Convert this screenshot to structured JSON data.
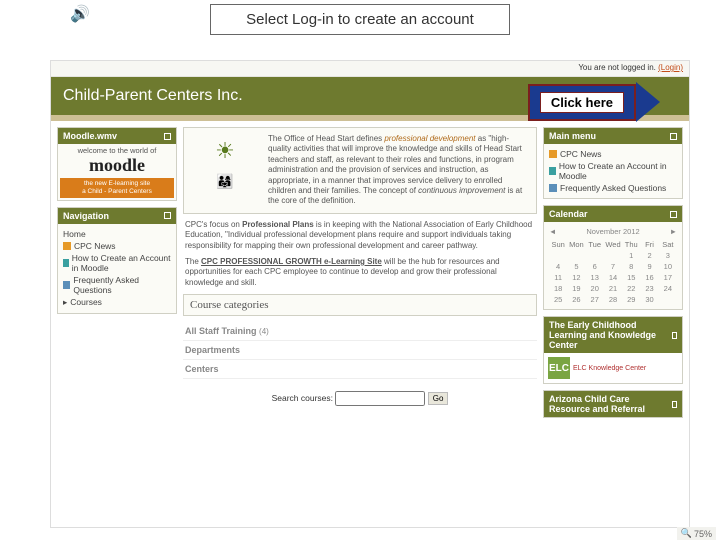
{
  "instruction": "Select Log-in to create an account",
  "callout": "Click here",
  "topbar": {
    "prefix": "You are not logged in.",
    "login_link": "(Login)"
  },
  "header": {
    "title": "Child-Parent Centers Inc."
  },
  "moodle_block": {
    "hd": "Moodle.wmv",
    "line1": "welcome to the world of",
    "logo": "moodle",
    "bar1": "the new E-learning site",
    "bar2": "a Child - Parent Centers"
  },
  "nav_block": {
    "hd": "Navigation",
    "home": "Home",
    "news": "CPC News",
    "create": "How to Create an Account in Moodle",
    "faq": "Frequently Asked Questions",
    "courses": "Courses",
    "arrow": "▸"
  },
  "intro": {
    "p1a": "The Office of Head Start defines ",
    "p1b": "professional development",
    "p1c": " as \"high-quality activities that will improve the knowledge and skills of Head Start teachers and staff, as relevant to their roles and functions, in program administration and the provision of services and instruction, as appropriate, in a manner that improves service delivery to enrolled children and their families. The concept of ",
    "p1d": "continuous improvement",
    "p1e": " is at the core of the definition."
  },
  "para2": {
    "a": "CPC's focus on ",
    "b": "Professional Plans",
    "c": " is in keeping with the National Association of Early Childhood Education, \"Individual professional development plans require and support individuals taking responsibility for mapping their own professional development and career pathway."
  },
  "para3": {
    "a": "The ",
    "b": "CPC PROFESSIONAL GROWTH e-Learning Site",
    "c": " will be the hub for resources and opportunities for each CPC employee to continue to develop and grow their professional knowledge and skill."
  },
  "course_cat": {
    "hd": "Course categories",
    "c1": "All Staff Training",
    "c1_count": "(4)",
    "c2": "Departments",
    "c3": "Centers"
  },
  "search": {
    "label": "Search courses:",
    "btn": "Go"
  },
  "mainmenu": {
    "hd": "Main menu",
    "news": "CPC News",
    "create": "How to Create an Account in Moodle",
    "faq": "Frequently Asked Questions"
  },
  "calendar": {
    "hd": "Calendar",
    "prev": "◄",
    "month": "November 2012",
    "next": "►",
    "days": [
      "Sun",
      "Mon",
      "Tue",
      "Wed",
      "Thu",
      "Fri",
      "Sat"
    ],
    "rows": [
      [
        "",
        "",
        "",
        "",
        "1",
        "2",
        "3"
      ],
      [
        "4",
        "5",
        "6",
        "7",
        "8",
        "9",
        "10"
      ],
      [
        "11",
        "12",
        "13",
        "14",
        "15",
        "16",
        "17"
      ],
      [
        "18",
        "19",
        "20",
        "21",
        "22",
        "23",
        "24"
      ],
      [
        "25",
        "26",
        "27",
        "28",
        "29",
        "30",
        ""
      ]
    ]
  },
  "eck": {
    "hd": "The Early Childhood Learning and Knowledge Center",
    "badge": "ELC",
    "txt": "ELC Knowledge Center"
  },
  "azcc": {
    "hd": "Arizona Child Care Resource and Referral"
  },
  "zoom": {
    "icon": "🔍",
    "value": "75%"
  }
}
